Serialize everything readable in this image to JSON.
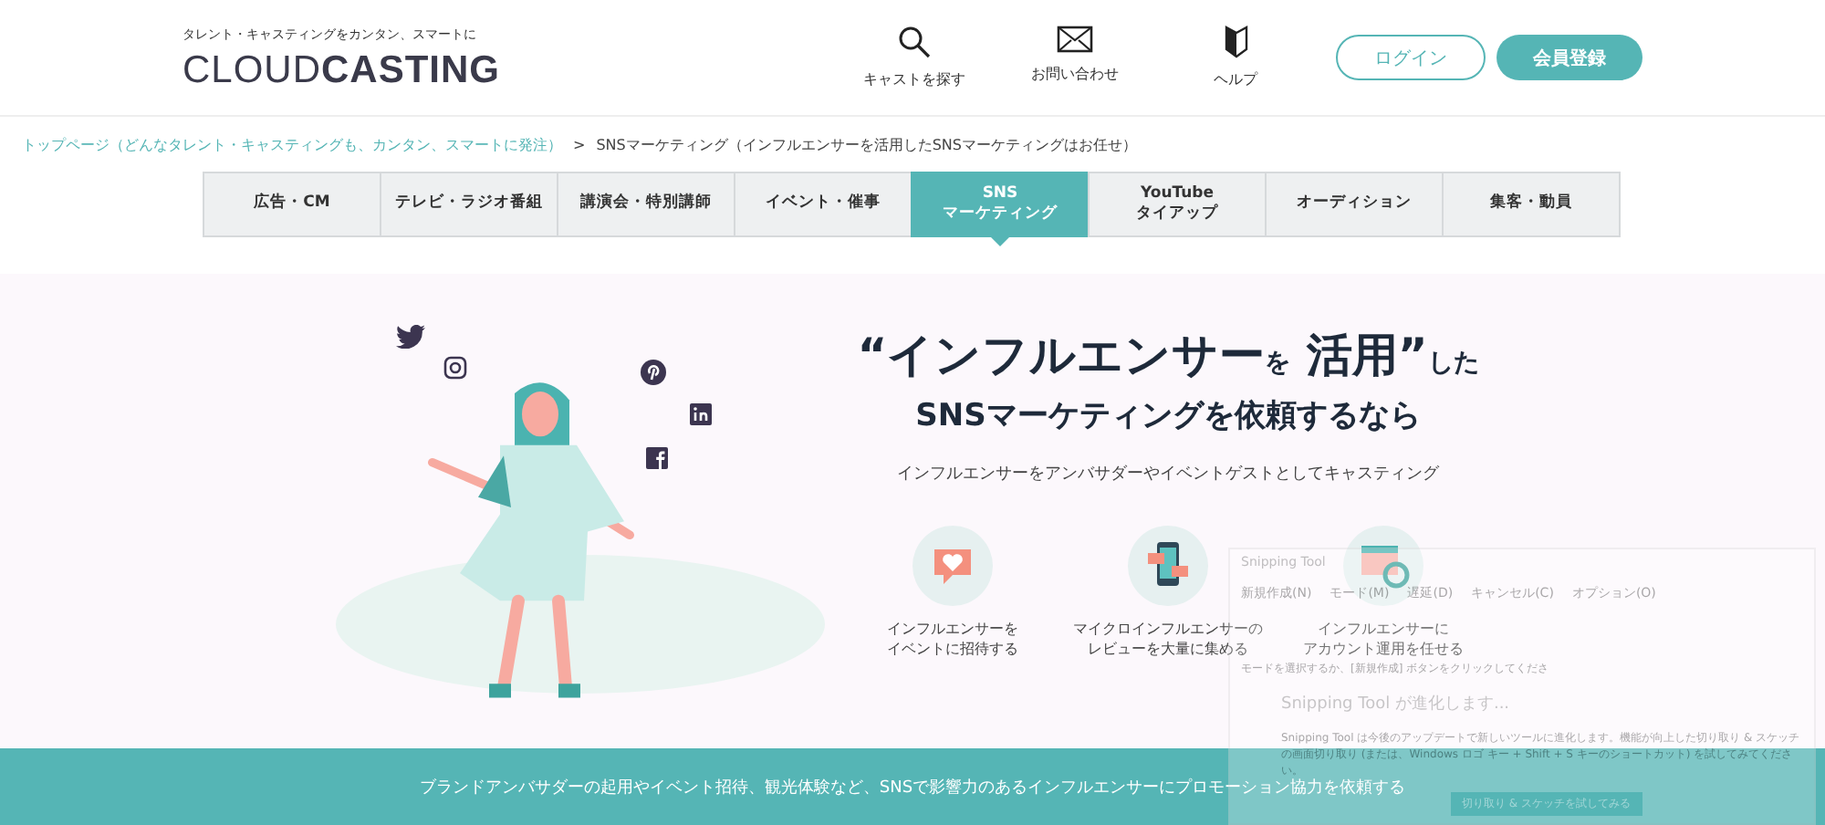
{
  "header": {
    "tagline": "タレント・キャスティングをカンタン、スマートに",
    "logo_light": "CLOUD",
    "logo_bold": "CASTING",
    "nav": [
      {
        "label": "キャストを探す",
        "kind": "search"
      },
      {
        "label": "お問い合わせ",
        "kind": "mail"
      },
      {
        "label": "ヘルプ",
        "kind": "help"
      }
    ],
    "login": "ログイン",
    "register": "会員登録"
  },
  "breadcrumb": {
    "home": "トップページ（どんなタレント・キャスティングも、カンタン、スマートに発注）",
    "separator": ">",
    "current": "SNSマーケティング（インフルエンサーを活用したSNSマーケティングはお任せ）"
  },
  "categories": [
    {
      "label": "広告・CM",
      "selected": false
    },
    {
      "label": "テレビ・ラジオ番組",
      "selected": false
    },
    {
      "label": "講演会・特別講師",
      "selected": false
    },
    {
      "label": "イベント・催事",
      "selected": false
    },
    {
      "label": "SNS\nマーケティング",
      "selected": true
    },
    {
      "label": "YouTube\nタイアップ",
      "selected": false
    },
    {
      "label": "オーディション",
      "selected": false
    },
    {
      "label": "集客・動員",
      "selected": false
    }
  ],
  "hero": {
    "title_open": "“",
    "title_main": "インフルエンサー",
    "title_particle": "を",
    "title_word": "活用",
    "title_close": "”",
    "title_tail": "した",
    "subtitle": "SNSマーケティングを依頼するなら",
    "lead": "インフルエンサーをアンバサダーやイベントゲストとしてキャスティング",
    "features": [
      {
        "kind": "heart",
        "lines": [
          "インフルエンサーを",
          "イベントに招待する"
        ]
      },
      {
        "kind": "phone",
        "lines": [
          "マイクロインフルエンサーの",
          "レビューを大量に集める"
        ]
      },
      {
        "kind": "account",
        "lines": [
          "インフルエンサーに",
          "アカウント運用を任せる"
        ]
      }
    ]
  },
  "banner": "ブランドアンバサダーの起用やイベント招待、観光体験など、SNSで影響力のあるインフルエンサーにプロモーション協力を依頼する",
  "snipping_tool": {
    "title": "Snipping Tool",
    "toolbar": [
      "新規作成(N)",
      "モード(M)",
      "遅延(D)",
      "キャンセル(C)",
      "オプション(O)"
    ],
    "hint": "モードを選択するか、[新規作成] ボタンをクリックしてくださ",
    "notice_title": "Snipping Tool が進化します...",
    "notice_body": "Snipping Tool は今後のアップデートで新しいツールに進化します。機能が向上した切り取り & スケッチの画面切り取り (または、Windows ロゴ キー + Shift + S キーのショートカット) を試してみてください。",
    "notice_button": "切り取り & スケッチを試してみる"
  }
}
